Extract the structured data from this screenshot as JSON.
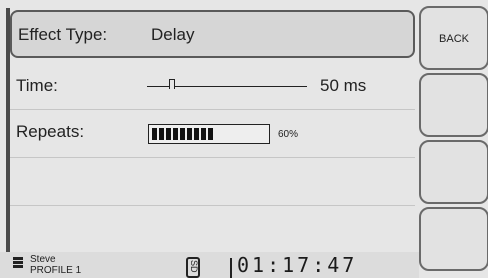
{
  "effect_type": {
    "label": "Effect Type:",
    "value": "Delay"
  },
  "time": {
    "label": "Time:",
    "value": "50 ms",
    "slider_level": 0.15
  },
  "repeats": {
    "label": "Repeats:",
    "percent_label": "60%",
    "meter_level": 0.6,
    "meter_segments": 9
  },
  "side_buttons": [
    {
      "label": "BACK"
    },
    {
      "label": ""
    },
    {
      "label": ""
    },
    {
      "label": ""
    }
  ],
  "status_bar": {
    "user_name": "Steve",
    "profile": "PROFILE 1",
    "badge": "SD",
    "clock": "01:17:47"
  },
  "icons": {
    "user": "user-icon",
    "storage": "sd-card-icon"
  }
}
